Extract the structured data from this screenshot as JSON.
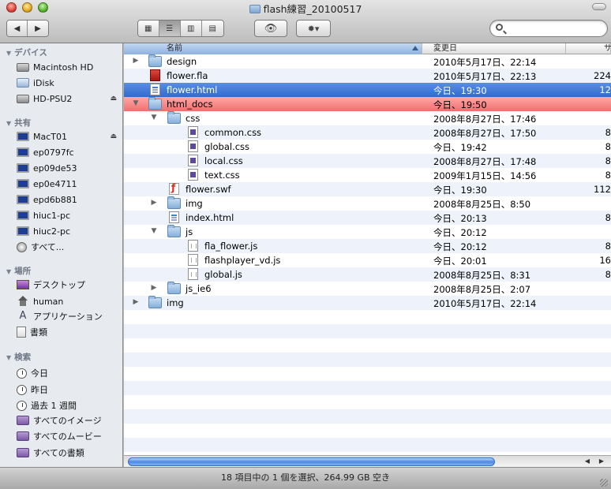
{
  "window": {
    "title": "flash練習_20100517",
    "status_text": "18 項目中の 1 個を選択、264.99 GB 空き"
  },
  "toolbar": {
    "back_label": "◀",
    "forward_label": "▶",
    "view_icon_label": "▦",
    "view_list_label": "☰",
    "view_column_label": "▥",
    "view_coverflow_label": "▤",
    "quicklook_label": "👁",
    "action_label": "✹▾",
    "search_placeholder": ""
  },
  "sidebar": {
    "devices_header": "デバイス",
    "devices": [
      {
        "label": "Macintosh HD"
      },
      {
        "label": "iDisk"
      },
      {
        "label": "HD-PSU2"
      }
    ],
    "shared_header": "共有",
    "shared": [
      {
        "label": "MacT01"
      },
      {
        "label": "ep0797fc"
      },
      {
        "label": "ep09de53"
      },
      {
        "label": "ep0e4711"
      },
      {
        "label": "epd6b881"
      },
      {
        "label": "hiuc1-pc"
      },
      {
        "label": "hiuc2-pc"
      },
      {
        "label": "すべて..."
      }
    ],
    "places_header": "場所",
    "places": [
      {
        "label": "デスクトップ"
      },
      {
        "label": "human"
      },
      {
        "label": "アプリケーション"
      },
      {
        "label": "書類"
      }
    ],
    "search_header": "検索",
    "searches": [
      {
        "label": "今日"
      },
      {
        "label": "昨日"
      },
      {
        "label": "過去 1 週間"
      },
      {
        "label": "すべてのイメージ"
      },
      {
        "label": "すべてのムービー"
      },
      {
        "label": "すべての書類"
      }
    ]
  },
  "columns": {
    "name": "名前",
    "date": "変更日",
    "size": "サ"
  },
  "files": [
    {
      "name": "design",
      "date": "2010年5月17日、22:14",
      "size": "",
      "icon": "folder-icon"
    },
    {
      "name": "flower.fla",
      "date": "2010年5月17日、22:13",
      "size": "224",
      "icon": "fla-file-icon"
    },
    {
      "name": "flower.html",
      "date": "今日、19:30",
      "size": "12",
      "icon": "html-file-icon"
    },
    {
      "name": "html_docs",
      "date": "今日、19:50",
      "size": "",
      "icon": "folder-icon"
    },
    {
      "name": "css",
      "date": "2008年8月27日、17:46",
      "size": "",
      "icon": "folder-icon"
    },
    {
      "name": "common.css",
      "date": "2008年8月27日、17:50",
      "size": "8",
      "icon": "css-file-icon"
    },
    {
      "name": "global.css",
      "date": "今日、19:42",
      "size": "8",
      "icon": "css-file-icon"
    },
    {
      "name": "local.css",
      "date": "2008年8月27日、17:48",
      "size": "8",
      "icon": "css-file-icon"
    },
    {
      "name": "text.css",
      "date": "2009年1月15日、14:56",
      "size": "8",
      "icon": "css-file-icon"
    },
    {
      "name": "flower.swf",
      "date": "今日、19:30",
      "size": "112",
      "icon": "swf-file-icon"
    },
    {
      "name": "img",
      "date": "2008年8月25日、8:50",
      "size": "",
      "icon": "folder-icon"
    },
    {
      "name": "index.html",
      "date": "今日、20:13",
      "size": "8",
      "icon": "html-file-icon"
    },
    {
      "name": "js",
      "date": "今日、20:12",
      "size": "",
      "icon": "folder-icon"
    },
    {
      "name": "fla_flower.js",
      "date": "今日、20:12",
      "size": "8",
      "icon": "js-file-icon"
    },
    {
      "name": "flashplayer_vd.js",
      "date": "今日、20:01",
      "size": "16",
      "icon": "js-file-icon"
    },
    {
      "name": "global.js",
      "date": "2008年8月25日、8:31",
      "size": "8",
      "icon": "js-file-icon"
    },
    {
      "name": "js_ie6",
      "date": "2008年8月25日、2:07",
      "size": "",
      "icon": "folder-icon"
    },
    {
      "name": "img",
      "date": "2010年5月17日、22:14",
      "size": "",
      "icon": "folder-icon"
    }
  ],
  "colors": {
    "selection": "#3a76d6",
    "label_red": "#f06a6a",
    "stripe": "#eef3fb"
  }
}
